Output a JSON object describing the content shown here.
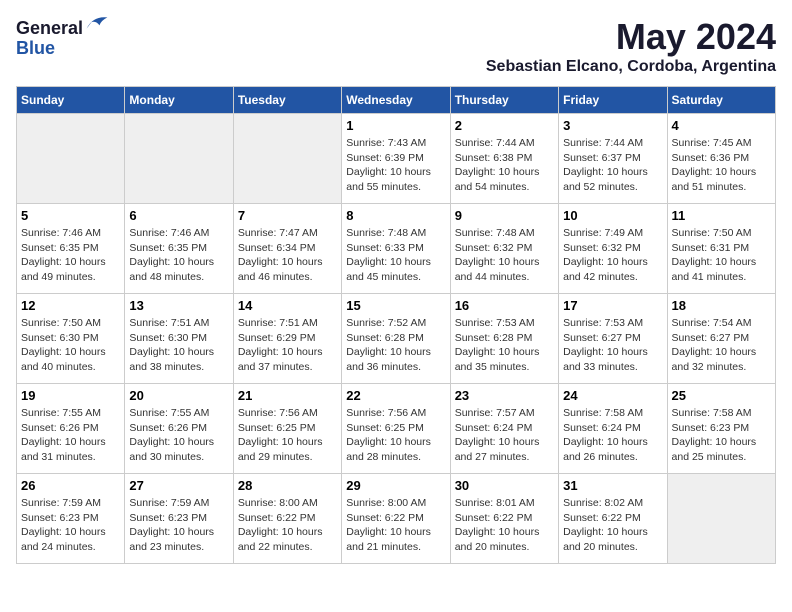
{
  "header": {
    "logo_line1": "General",
    "logo_line2": "Blue",
    "month_year": "May 2024",
    "location": "Sebastian Elcano, Cordoba, Argentina"
  },
  "weekdays": [
    "Sunday",
    "Monday",
    "Tuesday",
    "Wednesday",
    "Thursday",
    "Friday",
    "Saturday"
  ],
  "weeks": [
    [
      {
        "day": "",
        "sunrise": "",
        "sunset": "",
        "daylight": "",
        "empty": true
      },
      {
        "day": "",
        "sunrise": "",
        "sunset": "",
        "daylight": "",
        "empty": true
      },
      {
        "day": "",
        "sunrise": "",
        "sunset": "",
        "daylight": "",
        "empty": true
      },
      {
        "day": "1",
        "sunrise": "Sunrise: 7:43 AM",
        "sunset": "Sunset: 6:39 PM",
        "daylight": "Daylight: 10 hours and 55 minutes.",
        "empty": false
      },
      {
        "day": "2",
        "sunrise": "Sunrise: 7:44 AM",
        "sunset": "Sunset: 6:38 PM",
        "daylight": "Daylight: 10 hours and 54 minutes.",
        "empty": false
      },
      {
        "day": "3",
        "sunrise": "Sunrise: 7:44 AM",
        "sunset": "Sunset: 6:37 PM",
        "daylight": "Daylight: 10 hours and 52 minutes.",
        "empty": false
      },
      {
        "day": "4",
        "sunrise": "Sunrise: 7:45 AM",
        "sunset": "Sunset: 6:36 PM",
        "daylight": "Daylight: 10 hours and 51 minutes.",
        "empty": false
      }
    ],
    [
      {
        "day": "5",
        "sunrise": "Sunrise: 7:46 AM",
        "sunset": "Sunset: 6:35 PM",
        "daylight": "Daylight: 10 hours and 49 minutes.",
        "empty": false
      },
      {
        "day": "6",
        "sunrise": "Sunrise: 7:46 AM",
        "sunset": "Sunset: 6:35 PM",
        "daylight": "Daylight: 10 hours and 48 minutes.",
        "empty": false
      },
      {
        "day": "7",
        "sunrise": "Sunrise: 7:47 AM",
        "sunset": "Sunset: 6:34 PM",
        "daylight": "Daylight: 10 hours and 46 minutes.",
        "empty": false
      },
      {
        "day": "8",
        "sunrise": "Sunrise: 7:48 AM",
        "sunset": "Sunset: 6:33 PM",
        "daylight": "Daylight: 10 hours and 45 minutes.",
        "empty": false
      },
      {
        "day": "9",
        "sunrise": "Sunrise: 7:48 AM",
        "sunset": "Sunset: 6:32 PM",
        "daylight": "Daylight: 10 hours and 44 minutes.",
        "empty": false
      },
      {
        "day": "10",
        "sunrise": "Sunrise: 7:49 AM",
        "sunset": "Sunset: 6:32 PM",
        "daylight": "Daylight: 10 hours and 42 minutes.",
        "empty": false
      },
      {
        "day": "11",
        "sunrise": "Sunrise: 7:50 AM",
        "sunset": "Sunset: 6:31 PM",
        "daylight": "Daylight: 10 hours and 41 minutes.",
        "empty": false
      }
    ],
    [
      {
        "day": "12",
        "sunrise": "Sunrise: 7:50 AM",
        "sunset": "Sunset: 6:30 PM",
        "daylight": "Daylight: 10 hours and 40 minutes.",
        "empty": false
      },
      {
        "day": "13",
        "sunrise": "Sunrise: 7:51 AM",
        "sunset": "Sunset: 6:30 PM",
        "daylight": "Daylight: 10 hours and 38 minutes.",
        "empty": false
      },
      {
        "day": "14",
        "sunrise": "Sunrise: 7:51 AM",
        "sunset": "Sunset: 6:29 PM",
        "daylight": "Daylight: 10 hours and 37 minutes.",
        "empty": false
      },
      {
        "day": "15",
        "sunrise": "Sunrise: 7:52 AM",
        "sunset": "Sunset: 6:28 PM",
        "daylight": "Daylight: 10 hours and 36 minutes.",
        "empty": false
      },
      {
        "day": "16",
        "sunrise": "Sunrise: 7:53 AM",
        "sunset": "Sunset: 6:28 PM",
        "daylight": "Daylight: 10 hours and 35 minutes.",
        "empty": false
      },
      {
        "day": "17",
        "sunrise": "Sunrise: 7:53 AM",
        "sunset": "Sunset: 6:27 PM",
        "daylight": "Daylight: 10 hours and 33 minutes.",
        "empty": false
      },
      {
        "day": "18",
        "sunrise": "Sunrise: 7:54 AM",
        "sunset": "Sunset: 6:27 PM",
        "daylight": "Daylight: 10 hours and 32 minutes.",
        "empty": false
      }
    ],
    [
      {
        "day": "19",
        "sunrise": "Sunrise: 7:55 AM",
        "sunset": "Sunset: 6:26 PM",
        "daylight": "Daylight: 10 hours and 31 minutes.",
        "empty": false
      },
      {
        "day": "20",
        "sunrise": "Sunrise: 7:55 AM",
        "sunset": "Sunset: 6:26 PM",
        "daylight": "Daylight: 10 hours and 30 minutes.",
        "empty": false
      },
      {
        "day": "21",
        "sunrise": "Sunrise: 7:56 AM",
        "sunset": "Sunset: 6:25 PM",
        "daylight": "Daylight: 10 hours and 29 minutes.",
        "empty": false
      },
      {
        "day": "22",
        "sunrise": "Sunrise: 7:56 AM",
        "sunset": "Sunset: 6:25 PM",
        "daylight": "Daylight: 10 hours and 28 minutes.",
        "empty": false
      },
      {
        "day": "23",
        "sunrise": "Sunrise: 7:57 AM",
        "sunset": "Sunset: 6:24 PM",
        "daylight": "Daylight: 10 hours and 27 minutes.",
        "empty": false
      },
      {
        "day": "24",
        "sunrise": "Sunrise: 7:58 AM",
        "sunset": "Sunset: 6:24 PM",
        "daylight": "Daylight: 10 hours and 26 minutes.",
        "empty": false
      },
      {
        "day": "25",
        "sunrise": "Sunrise: 7:58 AM",
        "sunset": "Sunset: 6:23 PM",
        "daylight": "Daylight: 10 hours and 25 minutes.",
        "empty": false
      }
    ],
    [
      {
        "day": "26",
        "sunrise": "Sunrise: 7:59 AM",
        "sunset": "Sunset: 6:23 PM",
        "daylight": "Daylight: 10 hours and 24 minutes.",
        "empty": false
      },
      {
        "day": "27",
        "sunrise": "Sunrise: 7:59 AM",
        "sunset": "Sunset: 6:23 PM",
        "daylight": "Daylight: 10 hours and 23 minutes.",
        "empty": false
      },
      {
        "day": "28",
        "sunrise": "Sunrise: 8:00 AM",
        "sunset": "Sunset: 6:22 PM",
        "daylight": "Daylight: 10 hours and 22 minutes.",
        "empty": false
      },
      {
        "day": "29",
        "sunrise": "Sunrise: 8:00 AM",
        "sunset": "Sunset: 6:22 PM",
        "daylight": "Daylight: 10 hours and 21 minutes.",
        "empty": false
      },
      {
        "day": "30",
        "sunrise": "Sunrise: 8:01 AM",
        "sunset": "Sunset: 6:22 PM",
        "daylight": "Daylight: 10 hours and 20 minutes.",
        "empty": false
      },
      {
        "day": "31",
        "sunrise": "Sunrise: 8:02 AM",
        "sunset": "Sunset: 6:22 PM",
        "daylight": "Daylight: 10 hours and 20 minutes.",
        "empty": false
      },
      {
        "day": "",
        "sunrise": "",
        "sunset": "",
        "daylight": "",
        "empty": true
      }
    ]
  ]
}
